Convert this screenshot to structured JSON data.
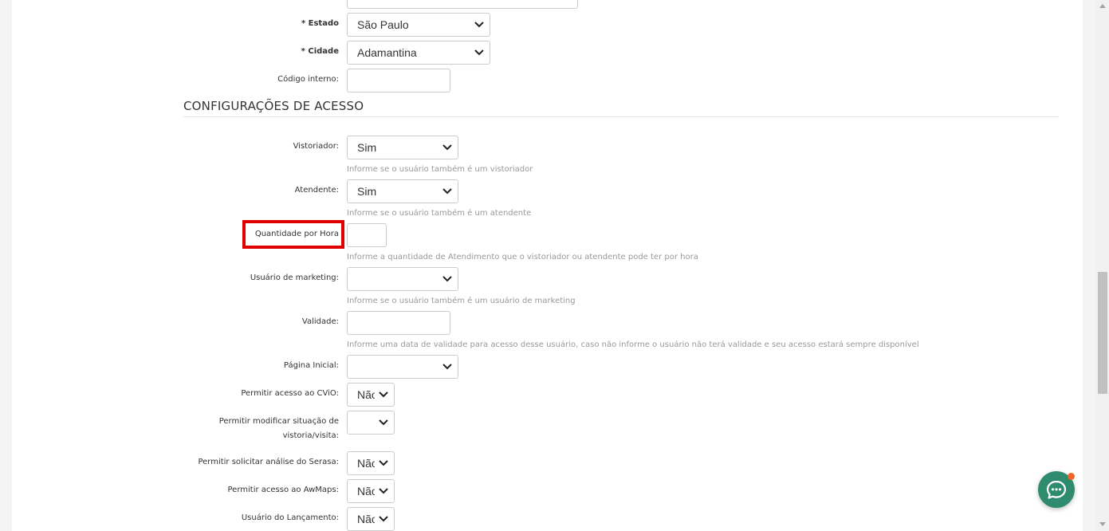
{
  "form": {
    "estado": {
      "label": "* Estado",
      "value": "São Paulo"
    },
    "cidade": {
      "label": "* Cidade",
      "value": "Adamantina"
    },
    "codigo_interno": {
      "label": "Código interno:"
    }
  },
  "section": {
    "title": "CONFIGURAÇÕES DE ACESSO"
  },
  "access": {
    "vistoriador": {
      "label": "Vistoriador:",
      "value": "Sim",
      "help": "Informe se o usuário também é um vistoriador"
    },
    "atendente": {
      "label": "Atendente:",
      "value": "Sim",
      "help": "Informe se o usuário também é um atendente"
    },
    "quantidade_hora": {
      "label": "Quantidade por Hora",
      "help": "Informe a quantidade de Atendimento que o vistoriador ou atendente pode ter por hora"
    },
    "usuario_marketing": {
      "label": "Usuário de marketing:",
      "value": "",
      "help": "Informe se o usuário também é um usuário de marketing"
    },
    "validade": {
      "label": "Validade:",
      "help": "Informe uma data de validade para acesso desse usuário, caso não informe o usuário não terá validade e seu acesso estará sempre disponível"
    },
    "pagina_inicial": {
      "label": "Página Inicial:",
      "value": ""
    },
    "acesso_cvio": {
      "label": "Permitir acesso ao CViO:",
      "value": "Não"
    },
    "modificar_situacao": {
      "label": "Permitir modificar situação de vistoria/visita:",
      "value": ""
    },
    "analise_serasa": {
      "label": "Permitir solicitar análise do Serasa:",
      "value": "Não"
    },
    "acesso_awmaps": {
      "label": "Permitir acesso ao AwMaps:",
      "value": "Não"
    },
    "usuario_lancamento": {
      "label": "Usuário do Lançamento:",
      "value": "Não"
    }
  },
  "colors": {
    "highlight": "#e00000",
    "chat": "#2e8b6e",
    "chat_badge": "#f26522"
  },
  "icons": {
    "chevron": "chevron-down-icon",
    "chat": "chat-bubble-icon"
  }
}
